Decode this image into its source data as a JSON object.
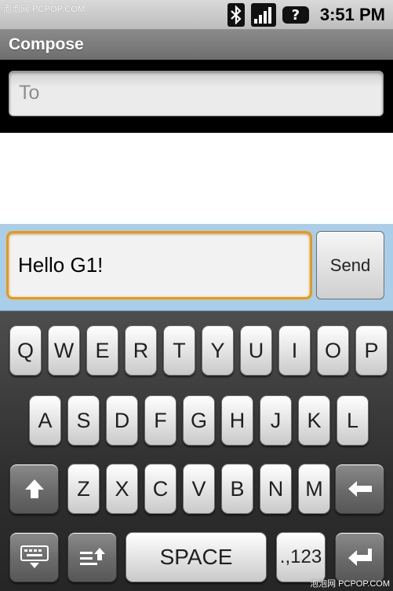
{
  "watermark_top": "泡泡网 PCPOP.COM",
  "watermark_bottom": "泡泡网 PCPOP.COM",
  "status": {
    "time": "3:51 PM",
    "icons": [
      "bluetooth-icon",
      "signal-strength-icon",
      "notification-icon"
    ],
    "notification_glyph": "?"
  },
  "title": "Compose",
  "to": {
    "placeholder": "To",
    "value": ""
  },
  "compose": {
    "text": "Hello G1!",
    "send_label": "Send"
  },
  "keyboard": {
    "row1": [
      "Q",
      "W",
      "E",
      "R",
      "T",
      "Y",
      "U",
      "I",
      "O",
      "P"
    ],
    "row2": [
      "A",
      "S",
      "D",
      "F",
      "G",
      "H",
      "J",
      "K",
      "L"
    ],
    "row3": [
      "Z",
      "X",
      "C",
      "V",
      "B",
      "N",
      "M"
    ],
    "space_label": "SPACE",
    "symbols_label": ".,123",
    "icons": [
      "shift-icon",
      "backspace-icon",
      "keyboard-hide-icon",
      "input-method-icon",
      "enter-icon"
    ]
  },
  "colors": {
    "accent": "#f39800",
    "compose_bar": "#a9ceea",
    "title_bar": "#7b7b7b"
  }
}
